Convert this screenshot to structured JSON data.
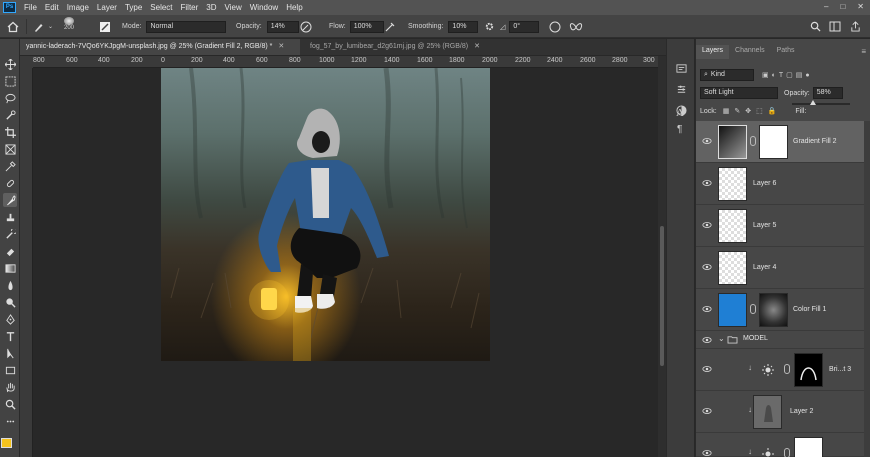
{
  "app": {
    "logo": "Ps"
  },
  "menu": [
    "File",
    "Edit",
    "Image",
    "Layer",
    "Type",
    "Select",
    "Filter",
    "3D",
    "View",
    "Window",
    "Help"
  ],
  "window_controls": [
    "–",
    "□",
    "✕"
  ],
  "options": {
    "brush_size": "200",
    "mode_label": "Mode:",
    "mode_value": "Normal",
    "opacity_label": "Opacity:",
    "opacity_value": "14%",
    "flow_label": "Flow:",
    "flow_value": "100%",
    "smoothing_label": "Smoothing:",
    "smoothing_value": "10%",
    "angle_value": "0°"
  },
  "tabs": [
    {
      "label": "yannic-laderach-7VQo6YKJpgM-unsplash.jpg @ 25% (Gradient Fill 2, RGB/8) *"
    },
    {
      "label": "fog_57_by_lumibear_d2g61mj.jpg @ 25% (RGB/8)"
    }
  ],
  "ruler": [
    "800",
    "600",
    "400",
    "200",
    "0",
    "200",
    "400",
    "600",
    "800",
    "1000",
    "1200",
    "1400",
    "1600",
    "1800",
    "2000",
    "2200",
    "2400",
    "2600",
    "2800",
    "300"
  ],
  "layers_panel": {
    "tabs": [
      "Layers",
      "Channels",
      "Paths"
    ],
    "filter_label": "Kind",
    "blend_mode": "Soft Light",
    "opacity_label": "Opacity:",
    "opacity_value": "58%",
    "lock_label": "Lock:",
    "fill_label": "Fill:",
    "layers": [
      {
        "name": "Gradient Fill 2",
        "selected": true
      },
      {
        "name": "Layer 6"
      },
      {
        "name": "Layer 5"
      },
      {
        "name": "Layer 4"
      },
      {
        "name": "Color Fill 1"
      },
      {
        "name": "MODEL"
      },
      {
        "name": "Bri...t 3"
      },
      {
        "name": "Layer 2"
      }
    ]
  },
  "colors": {
    "foreground": "#f4c21c",
    "accent": "#31a8ff",
    "color_fill_swatch": "#1f7fd4"
  }
}
